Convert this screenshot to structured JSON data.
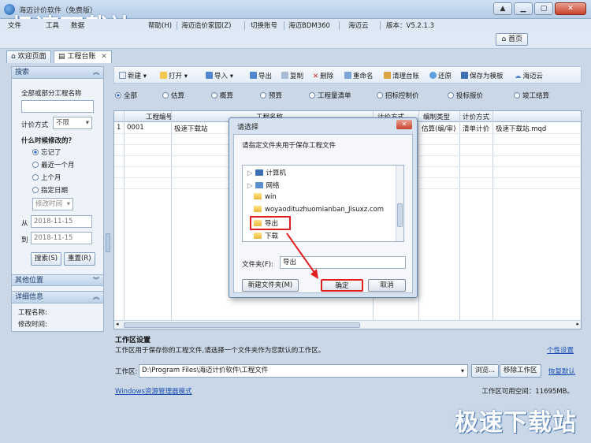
{
  "app": {
    "title": "海迈计价软件（免费版）",
    "watermark": "极速下载站"
  },
  "menu": {
    "items": [
      "文件",
      "工具",
      "数据",
      "帮助(H)",
      "海迈造价家园(Z)",
      "切换账号",
      "海迈BDM360",
      "海迈云",
      "版本：V5.2.1.3"
    ]
  },
  "nav": {
    "home_label": "首页"
  },
  "tabs": [
    {
      "label": "欢迎页面"
    },
    {
      "label": "工程台账"
    }
  ],
  "left_panel": {
    "search_header": "搜索",
    "name_label": "全部或部分工程名称",
    "name_value": "",
    "pricing_label": "计价方式",
    "pricing_value": "不限",
    "modified_heading": "什么时候修改的？",
    "radio_options": [
      "忘记了",
      "最近一个月",
      "上个月",
      "指定日期"
    ],
    "selected_radio": "忘记了",
    "date_field_placeholder": "修改时间",
    "from_label": "从",
    "from_date": "2018-11-15",
    "to_label": "到",
    "to_date": "2018-11-15",
    "search_button": "搜索(S)",
    "reset_button": "重置(R)",
    "other_location_header": "其他位置",
    "details_header": "详细信息",
    "project_name_label": "工程名称:",
    "modified_time_label": "修改时间:"
  },
  "toolbar": {
    "new": "新建",
    "open": "打开",
    "import": "导入",
    "export": "导出",
    "copy": "复制",
    "delete": "删除",
    "rename": "重命名",
    "clean": "清理台账",
    "restore": "还原",
    "save_template": "保存为模板",
    "cloud": "海迈云"
  },
  "filters": {
    "options": [
      "全部",
      "估算",
      "概算",
      "预算",
      "工程量清单",
      "招标控制价",
      "投标报价",
      "竣工结算"
    ],
    "selected": "全部"
  },
  "grid": {
    "headers": [
      "工程编号",
      "工程名称",
      "计价方式",
      "编制类型",
      "计价方式"
    ],
    "rows": [
      {
        "index": "1",
        "code": "0001",
        "name": "极速下载站",
        "type": "估算(编/审)",
        "method": "清单计价",
        "file": "极速下载站.mqd"
      }
    ]
  },
  "workspace": {
    "title": "工作区设置",
    "description": "工作区用于保存你的工程文件,请选择一个文件夹作为您默认的工作区。",
    "personalize_link": "个性设置",
    "label": "工作区:",
    "path": "D:\\Program Files\\海迈计价软件\\工程文件",
    "browse_button": "浏览...",
    "move_button": "移除工作区",
    "restore_link": "恢复默认",
    "explorer_link": "Windows资源管理器模式",
    "space_label": "工作区可用空间：11695MB。"
  },
  "dialog": {
    "title": "请选择",
    "close": "✕",
    "prompt": "请指定文件夹用于保存工程文件",
    "tree": [
      {
        "label": "计算机",
        "icon": "computer-icon"
      },
      {
        "label": "网络",
        "icon": "network-icon"
      },
      {
        "label": "win",
        "icon": "folder-icon"
      },
      {
        "label": "woyaodituzhuomianban_Jisuxz.com",
        "icon": "folder-icon"
      },
      {
        "label": "导出",
        "icon": "folder-icon"
      },
      {
        "label": "下载",
        "icon": "folder-icon"
      }
    ],
    "folder_label": "文件夹(F):",
    "folder_value": "导出",
    "new_folder_button": "新建文件夹(M)",
    "ok_button": "确定",
    "cancel_button": "取消",
    "highlight_color": "#e02020"
  }
}
